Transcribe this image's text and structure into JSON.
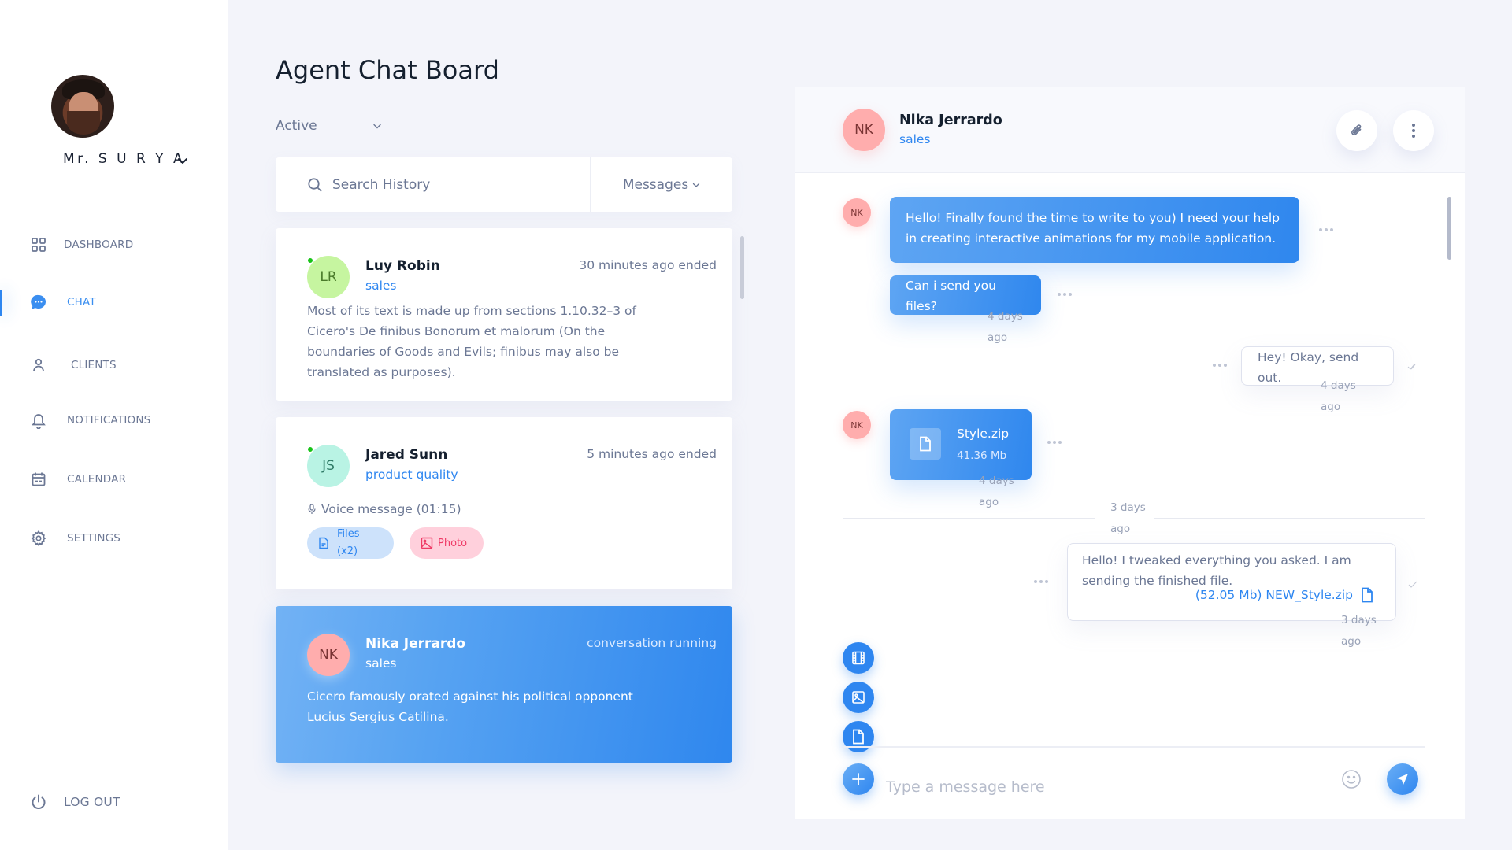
{
  "user": {
    "name": "Mr. S U R Y A"
  },
  "sidebar": {
    "items": [
      {
        "label": "DASHBOARD",
        "icon": "grid-icon",
        "active": false
      },
      {
        "label": "CHAT",
        "icon": "chat-bubble-icon",
        "active": true
      },
      {
        "label": "CLIENTS",
        "icon": "user-icon",
        "active": false
      },
      {
        "label": "NOTIFICATIONS",
        "icon": "bell-icon",
        "active": false
      },
      {
        "label": "CALENDAR",
        "icon": "calendar-icon",
        "active": false
      },
      {
        "label": "SETTINGS",
        "icon": "gear-icon",
        "active": false
      }
    ],
    "logout": "LOG OUT"
  },
  "main": {
    "title": "Agent Chat Board",
    "status_filter": "Active",
    "search": {
      "placeholder": "Search History",
      "value": ""
    },
    "type_filter": "Messages"
  },
  "conversations": [
    {
      "initials": "LR",
      "name": "Luy Robin",
      "dept": "sales",
      "time": "30 minutes ago ended",
      "online": true,
      "avatar_bg": "#c6f5a0",
      "avatar_fg": "#4a7a2a",
      "preview": "Most of its text is made up from sections 1.10.32–3 of Cicero's De finibus Bonorum et malorum (On the boundaries of Goods and Evils; finibus may also be translated as purposes)."
    },
    {
      "initials": "JS",
      "name": "Jared Sunn",
      "dept": "product quality",
      "time": "5 minutes ago ended",
      "online": true,
      "avatar_bg": "#b9f3e4",
      "avatar_fg": "#2f7a66",
      "voice": "Voice message (01:15)",
      "chips": {
        "files": "Files (x2)",
        "photo": "Photo"
      }
    },
    {
      "initials": "NK",
      "name": "Nika Jerrardo",
      "dept": "sales",
      "time": "conversation running",
      "online": false,
      "active": true,
      "avatar_bg": "#ffadad",
      "avatar_fg": "#7a3434",
      "preview": "Cicero famously orated against his political opponent Lucius Sergius Catilina."
    }
  ],
  "chat": {
    "contact": {
      "initials": "NK",
      "name": "Nika Jerrardo",
      "dept": "sales"
    },
    "messages": [
      {
        "from": "contact",
        "text": "Hello! Finally found the time to write to you) I need your help in creating interactive animations for my mobile application."
      },
      {
        "from": "contact",
        "text": "Can i send you files?",
        "time": "4 days ago"
      },
      {
        "from": "me",
        "text": "Hey! Okay, send out.",
        "time": "4 days ago",
        "status": "read"
      },
      {
        "from": "contact",
        "file": {
          "name": "Style.zip",
          "size": "41.36 Mb"
        },
        "time": "4 days ago"
      },
      {
        "divider_time": "3 days ago"
      },
      {
        "from": "me",
        "text": "Hello! I tweaked everything you asked. I am sending the finished file.",
        "attachment": "(52.05 Mb) NEW_Style.zip",
        "time": "3 days ago",
        "status": "sent"
      }
    ],
    "composer": {
      "placeholder": "Type a message here",
      "value": ""
    }
  },
  "colors": {
    "accent": "#2e86f0",
    "online": "#18c318",
    "photo_chip": "#ef3b67"
  }
}
